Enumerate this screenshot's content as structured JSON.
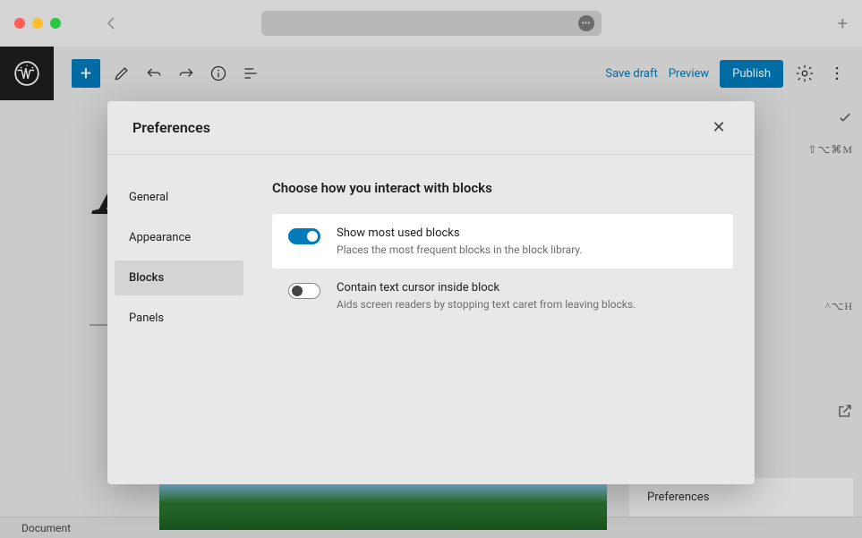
{
  "toolbar": {
    "save_draft": "Save draft",
    "preview": "Preview",
    "publish": "Publish"
  },
  "modal": {
    "title": "Preferences",
    "sidebar": {
      "general": "General",
      "appearance": "Appearance",
      "blocks": "Blocks",
      "panels": "Panels"
    },
    "content": {
      "heading": "Choose how you interact with blocks",
      "pref1": {
        "label": "Show most used blocks",
        "desc": "Places the most frequent blocks in the block library."
      },
      "pref2": {
        "label": "Contain text cursor inside block",
        "desc": "Aids screen readers by stopping text caret from leaving blocks."
      }
    }
  },
  "shortcuts": {
    "s1": "⇧⌥⌘M",
    "s2": "^⌥H"
  },
  "context_menu": {
    "preferences": "Preferences"
  },
  "status": {
    "document": "Document"
  }
}
